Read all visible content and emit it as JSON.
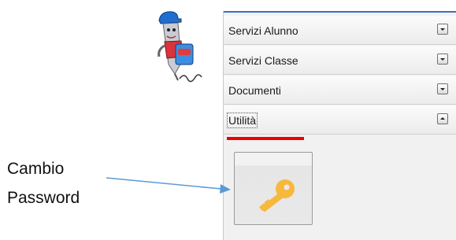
{
  "panel": {
    "items": [
      {
        "label": "Servizi Alunno",
        "state": "collapsed"
      },
      {
        "label": "Servizi Classe",
        "state": "collapsed"
      },
      {
        "label": "Documenti",
        "state": "collapsed"
      },
      {
        "label": "Utilità",
        "state": "expanded"
      }
    ]
  },
  "utilita": {
    "tile_icon": "key-icon"
  },
  "annotation": {
    "line1": "Cambio",
    "line2": "Password"
  },
  "colors": {
    "highlight_underline": "#ee0000",
    "arrow": "#5b9bd5",
    "key": "#f7b83d",
    "panel_top_line": "#3d6dbf"
  }
}
